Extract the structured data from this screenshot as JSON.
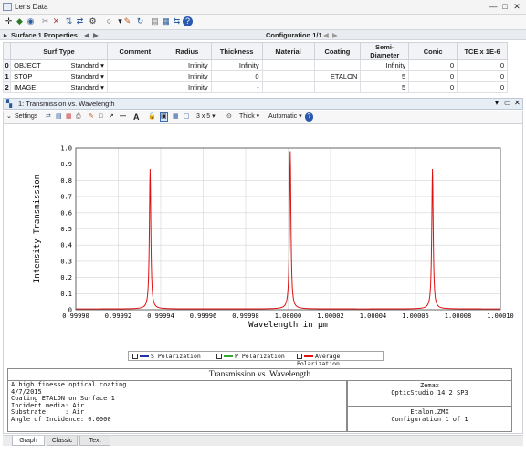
{
  "window": {
    "title": "Lens Data",
    "config_label": "Configuration 1/1",
    "surface_props": "Surface 1 Properties",
    "controls": [
      "—",
      "□",
      "✕"
    ]
  },
  "lens_table": {
    "headers": [
      "Surf:Type",
      "Comment",
      "Radius",
      "Thickness",
      "Material",
      "Coating",
      "Semi-Diameter",
      "Conic",
      "TCE x 1E-6"
    ],
    "rows": [
      {
        "num": "0",
        "name": "OBJECT",
        "type": "Standard",
        "comment": "",
        "radius": "Infinity",
        "thickness": "Infinity",
        "material": "",
        "coating": "",
        "semi": "Infinity",
        "conic": "0",
        "tce": "0"
      },
      {
        "num": "1",
        "name": "STOP",
        "type": "Standard",
        "comment": "",
        "radius": "Infinity",
        "thickness": "0",
        "material": "",
        "coating": "ETALON",
        "semi": "5",
        "conic": "0",
        "tce": "0"
      },
      {
        "num": "2",
        "name": "IMAGE",
        "type": "Standard",
        "comment": "",
        "radius": "Infinity",
        "thickness": "-",
        "material": "",
        "coating": "",
        "semi": "5",
        "conic": "0",
        "tce": "0"
      }
    ]
  },
  "analysis": {
    "window_title": "1: Transmission vs. Wavelength",
    "settings_label": "Settings",
    "layout_label": "3 x 5",
    "thick_label": "Thick",
    "automatic_label": "Automatic",
    "caption": "Transmission vs. Wavelength",
    "info_left": [
      "A high finesse optical coating",
      "4/7/2015",
      "Coating ETALON on Surface 1",
      "Incident media: Air",
      "Substrate     : Air",
      "Angle of Incidence: 0.0000"
    ],
    "info_right_top": [
      "Zemax",
      "OpticStudio 14.2 SP3"
    ],
    "info_right_bottom": [
      "Etalon.ZMX",
      "Configuration 1 of 1"
    ],
    "tabs": [
      "Graph",
      "Classic",
      "Text"
    ]
  },
  "chart_data": {
    "type": "line",
    "xlabel": "Wavelength in µm",
    "ylabel": "Intensity Transmission",
    "xlim": [
      0.9999,
      1.0001
    ],
    "ylim": [
      0,
      1.0
    ],
    "x_ticks": [
      "0.99990",
      "0.99992",
      "0.99994",
      "0.99996",
      "0.99998",
      "1.00000",
      "1.00002",
      "1.00004",
      "1.00006",
      "1.00008",
      "1.00010"
    ],
    "y_ticks": [
      "0",
      "0.1",
      "0.2",
      "0.3",
      "0.4",
      "0.5",
      "0.6",
      "0.7",
      "0.8",
      "0.9",
      "1.0"
    ],
    "grid": true,
    "legend_position": "bottom",
    "series": [
      {
        "name": "S Polarization",
        "color": "#2233aa",
        "values": []
      },
      {
        "name": "P Polarization",
        "color": "#33aa33",
        "values": []
      },
      {
        "name": "Average Polarization",
        "color": "#dd1111",
        "peaks": [
          {
            "x": 0.999935,
            "y": 0.87
          },
          {
            "x": 1.000001,
            "y": 0.98
          },
          {
            "x": 1.000068,
            "y": 0.87
          }
        ],
        "baseline": 0.005
      }
    ]
  }
}
